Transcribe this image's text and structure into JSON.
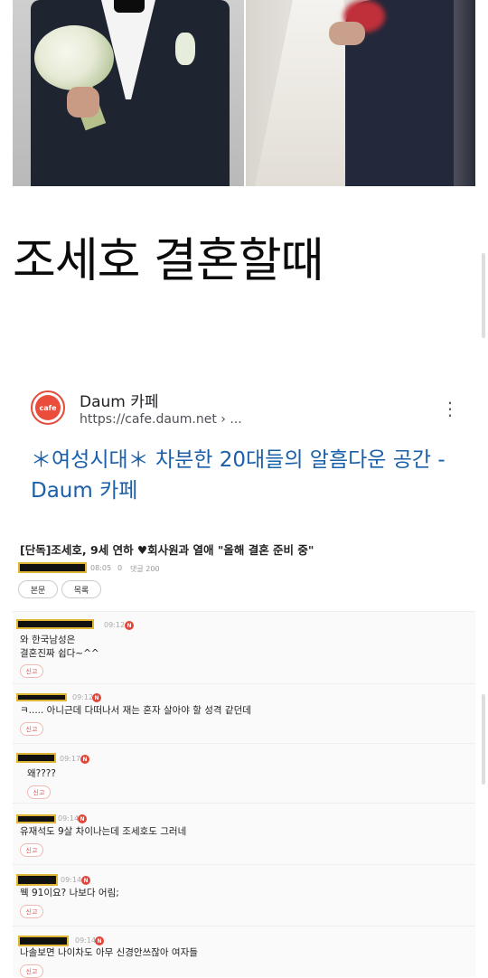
{
  "headline": "조세호 결혼할때",
  "search_result": {
    "logo_text": "cafe",
    "site_name": "Daum 카페",
    "url": "https://cafe.daum.net › ...",
    "more_icon": "more-vert-icon",
    "title": "＊여성시대＊ 차분한 20대들의 알흠다운 공간 - Daum 카페",
    "link_color": "#1a5fa8"
  },
  "post": {
    "title": "[단독]조세호, 9세 연하 ♥회사원과 열애 \"올해 결혼 준비 중\"",
    "time": "08:05",
    "views": "0",
    "comment_count_label": "댓글 200",
    "buttons": {
      "body": "본문",
      "list": "목록"
    },
    "comments": [
      {
        "time": "09:12",
        "text": "와 한국남성은\n결혼진짜 쉽다~^^",
        "report": "신고"
      },
      {
        "time": "09:12",
        "text": "ㅋ..... 아니근데 다떠나서 재는 혼자 살아야 할 성격 같던데",
        "report": "신고"
      },
      {
        "time": "09:17",
        "text": "왜????",
        "report": "신고"
      },
      {
        "time": "09:14",
        "text": "유재석도 9살 차이나는데 조세호도 그러네",
        "report": "신고"
      },
      {
        "time": "09:14",
        "text": "웩 91이요? 나보다 어림;",
        "report": "신고"
      },
      {
        "time": "09:14",
        "text": "나솔보면 나이차도 아무 신경안쓰잖아 여자들",
        "report": "신고"
      }
    ],
    "new_badge": "N"
  }
}
